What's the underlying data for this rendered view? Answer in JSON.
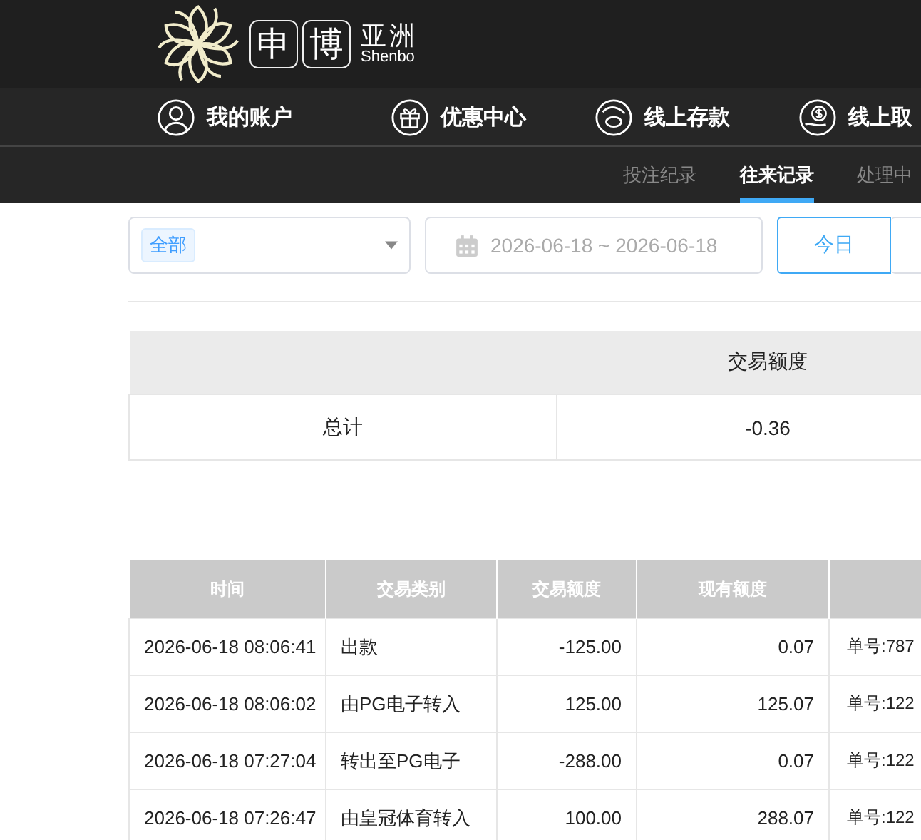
{
  "header": {
    "logo": {
      "chars": [
        "申",
        "博"
      ],
      "name": "亚洲",
      "latin": "Shenbo"
    }
  },
  "nav": [
    {
      "label": "我的账户",
      "kind": "user"
    },
    {
      "label": "优惠中心",
      "kind": "gift"
    },
    {
      "label": "线上存款",
      "kind": "deposit"
    },
    {
      "label": "线上取",
      "kind": "withdraw"
    }
  ],
  "sub_tabs": [
    {
      "label": "投注纪录",
      "selected": false
    },
    {
      "label": "往来记录",
      "selected": true
    },
    {
      "label": "处理中",
      "selected": false
    }
  ],
  "filter": {
    "category_tag": "全部",
    "date_range": "2026-06-18 ~ 2026-06-18",
    "quick_buttons": [
      {
        "label": "今日",
        "selected": true
      }
    ]
  },
  "summary": {
    "columns": [
      "交易额度"
    ],
    "rows": [
      {
        "label": "总计",
        "value": "-0.36"
      }
    ]
  },
  "transactions": {
    "columns": [
      "时间",
      "交易类别",
      "交易额度",
      "现有额度"
    ],
    "rows": [
      {
        "time": "2026-06-18 08:06:41",
        "type": "出款",
        "amount": "-125.00",
        "balance": "0.07",
        "note": "单号:787"
      },
      {
        "time": "2026-06-18 08:06:02",
        "type": "由PG电子转入",
        "amount": "125.00",
        "balance": "125.07",
        "note": "单号:122"
      },
      {
        "time": "2026-06-18 07:27:04",
        "type": "转出至PG电子",
        "amount": "-288.00",
        "balance": "0.07",
        "note": "单号:122"
      },
      {
        "time": "2026-06-18 07:26:47",
        "type": "由皇冠体育转入",
        "amount": "100.00",
        "balance": "288.07",
        "note": "单号:122"
      }
    ]
  }
}
